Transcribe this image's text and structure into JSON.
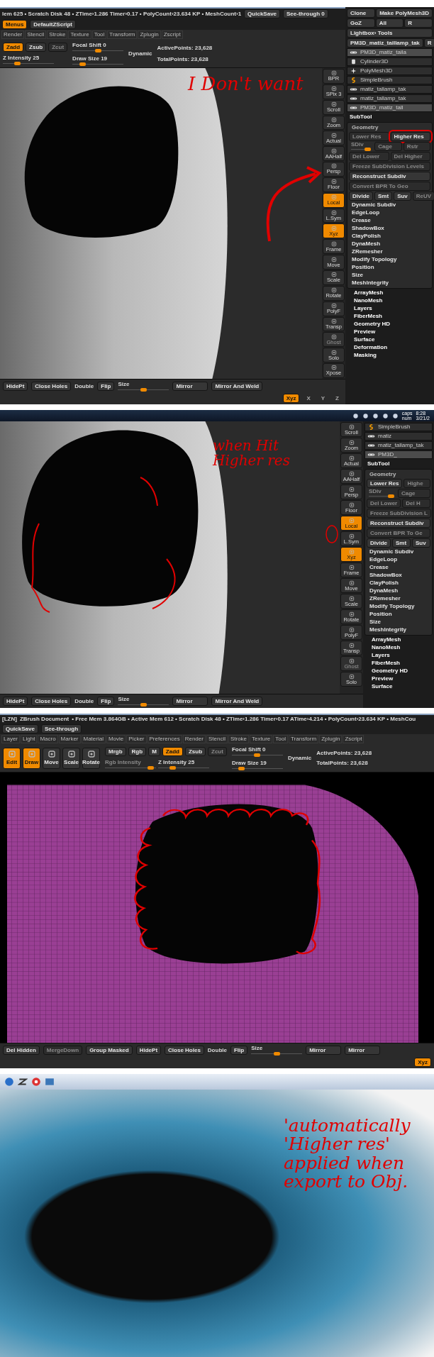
{
  "screenshots": [
    {
      "kind": "zbrush",
      "status": {
        "text": "lem 625 • Scratch Disk 48 • ZTime›1.286 Timer›0.17 • PolyCount›23.634 KP • MeshCount›1",
        "buttons": [
          {
            "label": "QuickSave",
            "selected": false
          },
          {
            "label": "See-through 0",
            "selected": false
          },
          {
            "label": "Menus",
            "selected": true
          },
          {
            "label": "DefaultZScript",
            "selected": false
          }
        ]
      },
      "menus": [
        "Render",
        "Stencil",
        "Stroke",
        "Texture",
        "Tool",
        "Transform",
        "Zplugin",
        "Zscript"
      ],
      "shelf": {
        "modes": [
          {
            "label": "Zadd",
            "selected": true,
            "disabled": false
          },
          {
            "label": "Zsub",
            "selected": false,
            "disabled": false
          },
          {
            "label": "Zcut",
            "selected": false,
            "disabled": true
          }
        ],
        "intensity_sliders": [
          {
            "label": "Z Intensity 25",
            "level": 0.25,
            "disabled": false
          }
        ],
        "brush_sliders": [
          {
            "label": "Focal Shift 0",
            "level": 0.5,
            "disabled": false
          },
          {
            "label": "Draw Size 19",
            "level": 0.15,
            "disabled": false
          }
        ],
        "dynamic": "Dynamic",
        "points": [
          "ActivePoints: 23,628",
          "TotalPoints: 23,628"
        ]
      },
      "viewport": {
        "kind": "grey_hole"
      },
      "side_icons": [
        {
          "label": "BPR",
          "selected": false,
          "disabled": false
        },
        {
          "label": "SPix 3",
          "selected": false,
          "disabled": false
        },
        {
          "label": "Scroll",
          "selected": false,
          "disabled": false
        },
        {
          "label": "Zoom",
          "selected": false,
          "disabled": false
        },
        {
          "label": "Actual",
          "selected": false,
          "disabled": false
        },
        {
          "label": "AAHalf",
          "selected": false,
          "disabled": false
        },
        {
          "label": "Persp",
          "selected": false,
          "disabled": false
        },
        {
          "label": "Floor",
          "selected": false,
          "disabled": false
        },
        {
          "label": "Local",
          "selected": true,
          "disabled": false
        },
        {
          "label": "L.Sym",
          "selected": false,
          "disabled": false
        },
        {
          "label": "Xyz",
          "selected": true,
          "disabled": false
        },
        {
          "label": "Frame",
          "selected": false,
          "disabled": false
        },
        {
          "label": "Move",
          "selected": false,
          "disabled": false
        },
        {
          "label": "Scale",
          "selected": false,
          "disabled": false
        },
        {
          "label": "Rotate",
          "selected": false,
          "disabled": false
        },
        {
          "label": "PolyF",
          "selected": false,
          "disabled": false
        },
        {
          "label": "Transp",
          "selected": false,
          "disabled": false
        },
        {
          "label": "Ghost",
          "selected": false,
          "disabled": true
        },
        {
          "label": "Solo",
          "selected": false,
          "disabled": false
        },
        {
          "label": "Xpose",
          "selected": false,
          "disabled": false
        }
      ],
      "palette": {
        "tool_rows": [
          [
            "Clone",
            "Make PolyMesh3D"
          ],
          [
            "GoZ",
            "All",
            "R"
          ],
          [
            "Lightbox› Tools"
          ],
          [
            "PM3D_matiz_taillamp_tak",
            "R"
          ]
        ],
        "thumbnails": [
          {
            "label": "PM3D_matiz_taila",
            "kind": "mesh",
            "selected": true
          },
          {
            "label": "Cylinder3D",
            "kind": "cylinder",
            "selected": false
          },
          {
            "label": "PolyMesh3D",
            "kind": "star",
            "selected": false
          },
          {
            "label": "SimpleBrush",
            "kind": "brush",
            "selected": false
          },
          {
            "label": "matiz_tallamp_tak",
            "kind": "mesh",
            "selected": false
          },
          {
            "label": "matiz_tallamp_tak",
            "kind": "mesh",
            "selected": false
          },
          {
            "label": "PM3D_matiz_tall",
            "kind": "mesh",
            "selected": true
          }
        ],
        "subtool": "SubTool",
        "geometry": {
          "title": "Geometry",
          "lines": [
            {
              "buttons": [
                {
                  "kind": "button",
                  "label": "Lower Res",
                  "disabled": true,
                  "circled": false
                },
                {
                  "kind": "button",
                  "label": "Higher Res",
                  "disabled": false,
                  "circled": true
                }
              ]
            },
            {
              "buttons": [
                {
                  "kind": "slider",
                  "label": "SDiv",
                  "disabled": true,
                  "level": 1
                },
                {
                  "kind": "button",
                  "label": "Cage",
                  "disabled": true,
                  "circled": false
                },
                {
                  "kind": "button",
                  "label": "Rstr",
                  "disabled": true,
                  "circled": false
                }
              ]
            },
            {
              "buttons": [
                {
                  "kind": "button",
                  "label": "Del Lower",
                  "disabled": true,
                  "circled": false
                },
                {
                  "kind": "button",
                  "label": "Del Higher",
                  "disabled": true,
                  "circled": false
                }
              ]
            },
            {
              "buttons": [
                {
                  "kind": "button",
                  "label": "Freeze SubDivision Levels",
                  "disabled": true,
                  "circled": false
                }
              ]
            },
            {
              "buttons": [
                {
                  "kind": "button",
                  "label": "Reconstruct Subdiv",
                  "disabled": false,
                  "circled": false
                }
              ]
            },
            {
              "buttons": [
                {
                  "kind": "button",
                  "label": "Convert BPR To Geo",
                  "disabled": true,
                  "circled": false
                }
              ]
            },
            {
              "buttons": [
                {
                  "kind": "button",
                  "label": "Divide",
                  "disabled": false,
                  "circled": false
                },
                {
                  "kind": "button",
                  "label": "Smt",
                  "disabled": false,
                  "circled": false
                },
                {
                  "kind": "button",
                  "label": "Suv",
                  "disabled": false,
                  "circled": false
                },
                {
                  "kind": "button",
                  "label": "ReUV",
                  "disabled": true,
                  "circled": false
                }
              ]
            }
          ],
          "items": [
            "Dynamic Subdiv",
            "EdgeLoop",
            "Crease",
            "ShadowBox",
            "ClayPolish",
            "DynaMesh",
            "ZRemesher",
            "Modify Topology",
            "Position",
            "Size",
            "MeshIntegrity"
          ]
        },
        "menus": [
          "ArrayMesh",
          "NanoMesh",
          "Layers",
          "FiberMesh",
          "Geometry HD",
          "Preview",
          "Surface",
          "Deformation",
          "Masking"
        ]
      },
      "bottom": {
        "items": [
          {
            "kind": "button",
            "label": "HidePt",
            "disabled": false
          },
          {
            "kind": "button",
            "label": "Close Holes",
            "disabled": false
          },
          {
            "kind": "label",
            "label": "Double",
            "disabled": false
          },
          {
            "kind": "button",
            "label": "Flip",
            "disabled": false
          },
          {
            "kind": "slider",
            "label": "Size",
            "level": 0.5,
            "disabled": false
          },
          {
            "kind": "dropdown",
            "label": "Mirror",
            "disabled": false
          },
          {
            "kind": "dropdown",
            "label": "Mirror And Weld",
            "disabled": false
          }
        ],
        "axes": [
          {
            "label": "Xyz",
            "selected": true
          },
          {
            "label": "X",
            "selected": false
          },
          {
            "label": "Y",
            "selected": false
          },
          {
            "label": "Z",
            "selected": false
          }
        ]
      },
      "annotation": {
        "text": "I Don't want"
      }
    },
    {
      "kind": "zbrush",
      "taskbar": {
        "tray": [
          "caps",
          "num"
        ],
        "clock": [
          "8:28",
          "3/21/2"
        ]
      },
      "viewport": {
        "kind": "grey_hole"
      },
      "side_icons": [
        {
          "label": "Scroll",
          "selected": false,
          "disabled": false
        },
        {
          "label": "Zoom",
          "selected": false,
          "disabled": false
        },
        {
          "label": "Actual",
          "selected": false,
          "disabled": false
        },
        {
          "label": "AAHalf",
          "selected": false,
          "disabled": false
        },
        {
          "label": "Persp",
          "selected": false,
          "disabled": false
        },
        {
          "label": "Floor",
          "selected": false,
          "disabled": false
        },
        {
          "label": "Local",
          "selected": true,
          "disabled": false
        },
        {
          "label": "L.Sym",
          "selected": false,
          "disabled": false
        },
        {
          "label": "Xyz",
          "selected": true,
          "disabled": false
        },
        {
          "label": "Frame",
          "selected": false,
          "disabled": false
        },
        {
          "label": "Move",
          "selected": false,
          "disabled": false
        },
        {
          "label": "Scale",
          "selected": false,
          "disabled": false
        },
        {
          "label": "Rotate",
          "selected": false,
          "disabled": false
        },
        {
          "label": "PolyF",
          "selected": false,
          "disabled": false
        },
        {
          "label": "Transp",
          "selected": false,
          "disabled": false
        },
        {
          "label": "Ghost",
          "selected": false,
          "disabled": true
        },
        {
          "label": "Solo",
          "selected": false,
          "disabled": false
        }
      ],
      "palette": {
        "thumbnails": [
          {
            "label": "SimpleBrush",
            "kind": "brush",
            "selected": false
          },
          {
            "label": "matiz",
            "kind": "mesh",
            "selected": false
          },
          {
            "label": "matiz_tallamp_tak",
            "kind": "mesh",
            "selected": false
          },
          {
            "label": "PM3D_",
            "kind": "mesh",
            "selected": true
          }
        ],
        "subtool": "SubTool",
        "geometry": {
          "title": "Geometry",
          "lines": [
            {
              "buttons": [
                {
                  "kind": "button",
                  "label": "Lower Res",
                  "disabled": false
                },
                {
                  "kind": "button",
                  "label": "Highe",
                  "disabled": true
                }
              ]
            },
            {
              "buttons": [
                {
                  "kind": "slider",
                  "label": "SDiv",
                  "disabled": true,
                  "level": 1
                },
                {
                  "kind": "button",
                  "label": "Cage",
                  "disabled": true
                }
              ]
            },
            {
              "buttons": [
                {
                  "kind": "button",
                  "label": "Del Lower",
                  "disabled": true
                },
                {
                  "kind": "button",
                  "label": "Del H",
                  "disabled": true
                }
              ]
            },
            {
              "buttons": [
                {
                  "kind": "button",
                  "label": "Freeze SubDivision L",
                  "disabled": true
                }
              ]
            },
            {
              "buttons": [
                {
                  "kind": "button",
                  "label": "Reconstruct Subdiv",
                  "disabled": false
                }
              ]
            },
            {
              "buttons": [
                {
                  "kind": "button",
                  "label": "Convert BPR To Ge",
                  "disabled": true
                }
              ]
            },
            {
              "buttons": [
                {
                  "kind": "button",
                  "label": "Divide",
                  "disabled": false
                },
                {
                  "kind": "button",
                  "label": "Smt",
                  "disabled": false
                },
                {
                  "kind": "button",
                  "label": "Suv",
                  "disabled": false
                }
              ]
            }
          ],
          "items": [
            "Dynamic Subdiv",
            "EdgeLoop",
            "Crease",
            "ShadowBox",
            "ClayPolish",
            "DynaMesh",
            "ZRemesher",
            "Modify Topology",
            "Position",
            "Size",
            "MeshIntegrity"
          ]
        },
        "menus": [
          "ArrayMesh",
          "NanoMesh",
          "Layers",
          "FiberMesh",
          "Geometry HD",
          "Preview",
          "Surface"
        ]
      },
      "bottom": {
        "items": [
          {
            "kind": "button",
            "label": "HidePt",
            "disabled": false
          },
          {
            "kind": "button",
            "label": "Close Holes",
            "disabled": false
          },
          {
            "kind": "label",
            "label": "Double",
            "disabled": false
          },
          {
            "kind": "button",
            "label": "Flip",
            "disabled": false
          },
          {
            "kind": "slider",
            "label": "Size",
            "level": 0.5,
            "disabled": false
          },
          {
            "kind": "dropdown",
            "label": "Mirror",
            "disabled": false
          },
          {
            "kind": "dropdown",
            "label": "Mirror And Weld",
            "disabled": false
          }
        ]
      },
      "annotation": {
        "text": "when Hit Higher res"
      }
    },
    {
      "kind": "zbrush",
      "status": {
        "title": "[LZN]",
        "document": "ZBrush Document",
        "text": "• Free Mem 3.864GB • Active Mem 612 • Scratch Disk 48 • ZTime›1.286 Timer›0.17 ATime›4.214 • PolyCount›23.634 KP • MeshCou",
        "buttons": [
          {
            "label": "QuickSave",
            "selected": false
          },
          {
            "label": "See-through",
            "selected": false
          }
        ]
      },
      "menus": [
        "Layer",
        "Light",
        "Macro",
        "Marker",
        "Material",
        "Movie",
        "Picker",
        "Preferences",
        "Render",
        "Stencil",
        "Stroke",
        "Texture",
        "Tool",
        "Transform",
        "Zplugin",
        "Zscript"
      ],
      "shelf": {
        "tools": [
          {
            "label": "Edit",
            "selected": true
          },
          {
            "label": "Draw",
            "selected": true
          },
          {
            "label": "Move",
            "selected": false
          },
          {
            "label": "Scale",
            "selected": false
          },
          {
            "label": "Rotate",
            "selected": false
          }
        ],
        "modes": [
          {
            "label": "Mrgb",
            "selected": false,
            "disabled": false
          },
          {
            "label": "Rgb",
            "selected": false,
            "disabled": false
          },
          {
            "label": "M",
            "selected": false,
            "disabled": false
          },
          {
            "label": "Zadd",
            "selected": true,
            "disabled": false
          },
          {
            "label": "Zsub",
            "selected": false,
            "disabled": false
          },
          {
            "label": "Zcut",
            "selected": false,
            "disabled": true
          }
        ],
        "intensity_sliders": [
          {
            "label": "Rgb Intensity",
            "level": 0.95,
            "disabled": true
          },
          {
            "label": "Z Intensity 25",
            "level": 0.25,
            "disabled": false
          }
        ],
        "brush_sliders": [
          {
            "label": "Focal Shift 0",
            "level": 0.5,
            "disabled": false
          },
          {
            "label": "Draw Size 19",
            "level": 0.15,
            "disabled": false
          }
        ],
        "dynamic": "Dynamic",
        "points": [
          "ActivePoints: 23,628",
          "TotalPoints: 23,628"
        ]
      },
      "viewport": {
        "kind": "purple_mesh"
      },
      "bottom": {
        "items": [
          {
            "kind": "button",
            "label": "Del Hidden",
            "disabled": false
          },
          {
            "kind": "button",
            "label": "MergeDown",
            "disabled": true
          },
          {
            "kind": "button",
            "label": "Group Masked",
            "disabled": false
          },
          {
            "kind": "button",
            "label": "HidePt",
            "disabled": false
          },
          {
            "kind": "button",
            "label": "Close Holes",
            "disabled": false
          },
          {
            "kind": "label",
            "label": "Double",
            "disabled": false
          },
          {
            "kind": "button",
            "label": "Flip",
            "disabled": false
          },
          {
            "kind": "slider",
            "label": "Size",
            "level": 0.5,
            "disabled": false
          },
          {
            "kind": "dropdown",
            "label": "Mirror",
            "disabled": false
          },
          {
            "kind": "dropdown",
            "label": "Mirror",
            "disabled": false
          }
        ],
        "axes": [
          {
            "label": "Xyz",
            "selected": true
          }
        ]
      }
    },
    {
      "kind": "photo",
      "taskbar": {
        "apps": [
          {
            "kind": "start"
          },
          {
            "kind": "zbrush"
          },
          {
            "kind": "browser"
          },
          {
            "kind": "window"
          }
        ]
      },
      "annotation": {
        "text": "'automatically 'Higher res' applied when export to Obj."
      }
    }
  ]
}
